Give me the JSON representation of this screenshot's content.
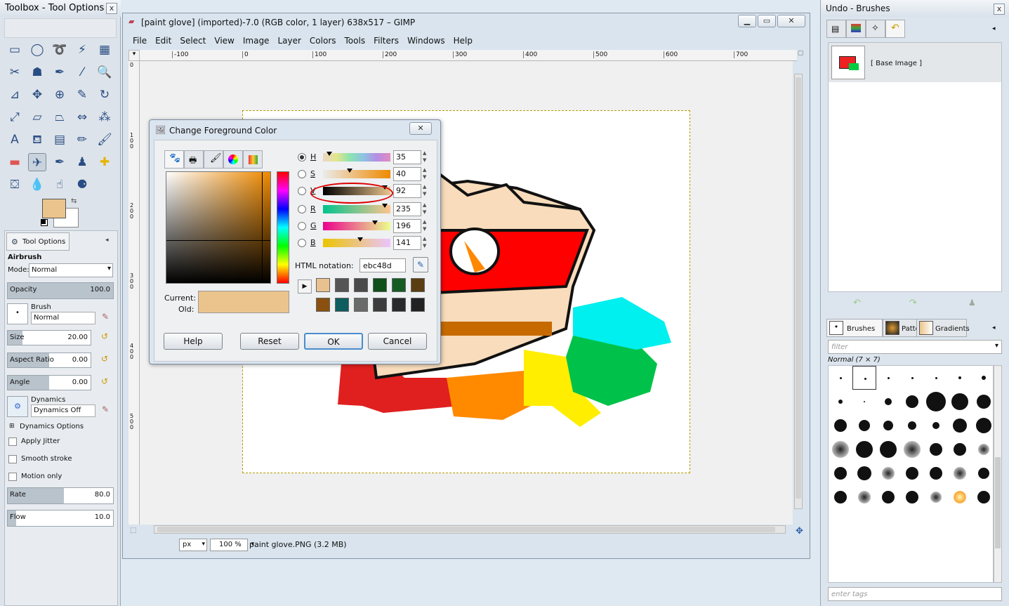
{
  "toolbox": {
    "title": "Toolbox - Tool Options",
    "close": "x",
    "tools": [
      "rect-select",
      "ellipse-select",
      "free-select",
      "fuzzy-select",
      "color-select",
      "scissors",
      "foreground-select",
      "paths",
      "color-picker",
      "zoom",
      "measure",
      "move",
      "align",
      "crop",
      "rotate",
      "scale",
      "shear",
      "perspective",
      "flip",
      "cage",
      "text",
      "bucket-fill",
      "blend",
      "pencil",
      "paintbrush",
      "eraser",
      "airbrush",
      "ink",
      "clone",
      "heal",
      "perspective-clone",
      "blur",
      "smudge",
      "dodge-burn"
    ],
    "tool_options_tab": "Tool Options",
    "tool_name": "Airbrush",
    "mode_label": "Mode:",
    "mode_value": "Normal",
    "opacity_label": "Opacity",
    "opacity_value": "100.0",
    "opacity_fill": 1.0,
    "brush_label": "Brush",
    "brush_value": "Normal",
    "size_label": "Size",
    "size_value": "20.00",
    "size_fill": 0.18,
    "aspect_label": "Aspect Ratio",
    "aspect_value": "0.00",
    "aspect_fill": 0.5,
    "angle_label": "Angle",
    "angle_value": "0.00",
    "angle_fill": 0.5,
    "dynamics_label": "Dynamics",
    "dynamics_value": "Dynamics Off",
    "dynamics_options": "Dynamics Options",
    "apply_jitter": "Apply Jitter",
    "smooth_stroke": "Smooth stroke",
    "motion_only": "Motion only",
    "rate_label": "Rate",
    "rate_value": "80.0",
    "rate_fill": 0.53,
    "flow_label": "Flow",
    "flow_value": "10.0",
    "flow_fill": 0.08,
    "fg_color": "#ebc48d",
    "bg_color": "#ffffff"
  },
  "gimp": {
    "title": "[paint glove] (imported)-7.0 (RGB color, 1 layer) 638x517 – GIMP",
    "menu": [
      "File",
      "Edit",
      "Select",
      "View",
      "Image",
      "Layer",
      "Colors",
      "Tools",
      "Filters",
      "Windows",
      "Help"
    ],
    "ruler_ticks": [
      "-100",
      "0",
      "100",
      "200",
      "300",
      "400",
      "500",
      "600",
      "700"
    ],
    "vruler_ticks": [
      "0",
      "1\n0\n0",
      "2\n0\n0",
      "3\n0\n0",
      "4\n0\n0",
      "5\n0\n0"
    ],
    "unit": "px",
    "zoom": "100 %",
    "status": "paint glove.PNG (3.2 MB)"
  },
  "dialog": {
    "title": "Change Foreground Color",
    "channels": [
      {
        "label": "H",
        "value": "35"
      },
      {
        "label": "S",
        "value": "40"
      },
      {
        "label": "V",
        "value": "92"
      },
      {
        "label": "R",
        "value": "235"
      },
      {
        "label": "G",
        "value": "196"
      },
      {
        "label": "B",
        "value": "141"
      }
    ],
    "html_label": "HTML notation:",
    "html_value": "ebc48d",
    "current_label": "Current:",
    "old_label": "Old:",
    "history": [
      "#e9c18f",
      "#555555",
      "#4a4a4a",
      "#0e4f1a",
      "#155c23",
      "#5a3e12",
      "#8b5010",
      "#0f5d5e",
      "#6a6a6a",
      "#3c3c3c",
      "#2a2a2a",
      "#222222"
    ],
    "buttons": {
      "help": "Help",
      "reset": "Reset",
      "ok": "OK",
      "cancel": "Cancel"
    }
  },
  "undo": {
    "title": "Undo - Brushes",
    "close": "x",
    "base_image": "[ Base Image ]"
  },
  "brushes": {
    "tabs": [
      "Brushes",
      "Patterns",
      "Gradients"
    ],
    "filter_placeholder": "filter",
    "brush_name": "Normal (7 × 7)",
    "tags_placeholder": "enter tags"
  }
}
